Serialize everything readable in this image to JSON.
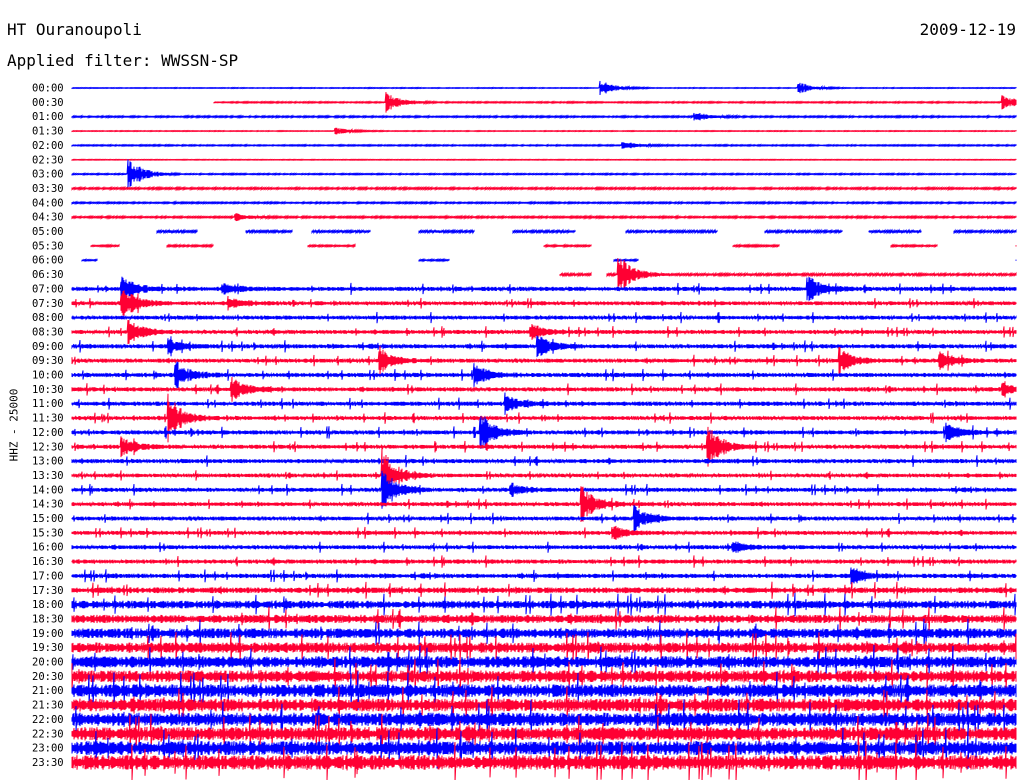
{
  "header": {
    "station": "HT Ouranoupoli",
    "date": "2009-12-19",
    "filter": "Applied filter: WWSSN-SP"
  },
  "axis_label": "HHZ - 25000",
  "colors": {
    "trace_a": "#0000ff",
    "trace_b": "#ff0033"
  },
  "chart_data": {
    "type": "line",
    "ylabel": "HHZ - 25000",
    "y_tick_labels": [
      "00:00",
      "00:30",
      "01:00",
      "01:30",
      "02:00",
      "02:30",
      "03:00",
      "03:30",
      "04:00",
      "04:30",
      "05:00",
      "05:30",
      "06:00",
      "06:30",
      "07:00",
      "07:30",
      "08:00",
      "08:30",
      "09:00",
      "09:30",
      "10:00",
      "10:30",
      "11:00",
      "11:30",
      "12:00",
      "12:30",
      "13:00",
      "13:30",
      "14:00",
      "14:30",
      "15:00",
      "15:30",
      "16:00",
      "16:30",
      "17:00",
      "17:30",
      "18:00",
      "18:30",
      "19:00",
      "19:30",
      "20:00",
      "20:30",
      "21:00",
      "21:30",
      "22:00",
      "22:30",
      "23:00",
      "23:30"
    ],
    "x_range_minutes": [
      0,
      30
    ],
    "series": [
      {
        "noise": 0.3,
        "events": [
          [
            16.8,
            1.3
          ],
          [
            23.1,
            1.0
          ]
        ],
        "gaps": []
      },
      {
        "noise": 0.5,
        "events": [
          [
            10.0,
            1.6
          ],
          [
            29.6,
            1.2
          ]
        ],
        "gaps": [
          [
            0,
            4.5
          ]
        ]
      },
      {
        "noise": 0.6,
        "events": [
          [
            19.8,
            0.8
          ]
        ],
        "gaps": []
      },
      {
        "noise": 0.3,
        "events": [
          [
            8.4,
            0.6
          ]
        ],
        "gaps": []
      },
      {
        "noise": 0.5,
        "events": [
          [
            17.5,
            0.8
          ]
        ],
        "gaps": []
      },
      {
        "noise": 0.3,
        "events": [],
        "gaps": []
      },
      {
        "noise": 0.5,
        "events": [
          [
            1.8,
            2.8
          ]
        ],
        "gaps": []
      },
      {
        "noise": 0.7,
        "events": [],
        "gaps": []
      },
      {
        "noise": 0.6,
        "events": [],
        "gaps": []
      },
      {
        "noise": 0.7,
        "events": [
          [
            5.2,
            0.6
          ]
        ],
        "gaps": []
      },
      {
        "noise": 0.9,
        "events": [],
        "gaps": [
          [
            0,
            2.7
          ],
          [
            4.0,
            5.5
          ],
          [
            7.0,
            7.6
          ],
          [
            9.5,
            11.0
          ],
          [
            12.8,
            14.0
          ],
          [
            16.0,
            17.6
          ],
          [
            20.5,
            22.0
          ],
          [
            24.5,
            25.3
          ],
          [
            27.0,
            28.0
          ]
        ]
      },
      {
        "noise": 0.7,
        "events": [],
        "gaps": [
          [
            0,
            0.6
          ],
          [
            1.5,
            3.0
          ],
          [
            4.5,
            7.5
          ],
          [
            9.0,
            15.0
          ],
          [
            16.5,
            21.0
          ],
          [
            22.5,
            26.0
          ],
          [
            27.5,
            30.0
          ]
        ]
      },
      {
        "noise": 0.6,
        "events": [],
        "gaps": [
          [
            0,
            0.3
          ],
          [
            0.8,
            11.0
          ],
          [
            12.0,
            17.2
          ],
          [
            18.0,
            30.0
          ]
        ]
      },
      {
        "noise": 0.9,
        "events": [
          [
            17.4,
            3.2
          ]
        ],
        "gaps": [
          [
            0,
            15.5
          ],
          [
            16.5,
            17.0
          ]
        ]
      },
      {
        "noise": 1.6,
        "events": [
          [
            1.6,
            2.2
          ],
          [
            4.8,
            1.0
          ],
          [
            23.4,
            2.0
          ]
        ],
        "gaps": []
      },
      {
        "noise": 1.5,
        "events": [
          [
            1.6,
            2.8
          ],
          [
            5.0,
            1.0
          ]
        ],
        "gaps": []
      },
      {
        "noise": 1.5,
        "events": [],
        "gaps": []
      },
      {
        "noise": 1.5,
        "events": [
          [
            1.8,
            2.2
          ],
          [
            14.6,
            1.4
          ]
        ],
        "gaps": []
      },
      {
        "noise": 1.6,
        "events": [
          [
            3.1,
            1.2
          ],
          [
            14.8,
            1.8
          ]
        ],
        "gaps": []
      },
      {
        "noise": 1.5,
        "events": [
          [
            9.8,
            2.0
          ],
          [
            24.4,
            2.0
          ],
          [
            27.6,
            1.5
          ]
        ],
        "gaps": []
      },
      {
        "noise": 1.6,
        "events": [
          [
            3.3,
            2.2
          ],
          [
            12.8,
            1.8
          ]
        ],
        "gaps": []
      },
      {
        "noise": 1.6,
        "events": [
          [
            5.1,
            2.0
          ],
          [
            29.6,
            1.0
          ]
        ],
        "gaps": []
      },
      {
        "noise": 1.6,
        "events": [
          [
            13.8,
            1.6
          ]
        ],
        "gaps": []
      },
      {
        "noise": 1.5,
        "events": [
          [
            3.1,
            3.5
          ]
        ],
        "gaps": []
      },
      {
        "noise": 1.6,
        "events": [
          [
            13.0,
            3.2
          ],
          [
            27.8,
            1.5
          ]
        ],
        "gaps": []
      },
      {
        "noise": 1.5,
        "events": [
          [
            1.6,
            1.6
          ],
          [
            20.2,
            3.5
          ]
        ],
        "gaps": []
      },
      {
        "noise": 1.6,
        "events": [],
        "gaps": []
      },
      {
        "noise": 1.4,
        "events": [
          [
            9.9,
            4.0
          ]
        ],
        "gaps": []
      },
      {
        "noise": 1.5,
        "events": [
          [
            9.9,
            3.2
          ],
          [
            14.0,
            1.0
          ]
        ],
        "gaps": []
      },
      {
        "noise": 1.5,
        "events": [
          [
            16.2,
            3.0
          ]
        ],
        "gaps": []
      },
      {
        "noise": 1.5,
        "events": [
          [
            17.9,
            2.0
          ]
        ],
        "gaps": []
      },
      {
        "noise": 1.5,
        "events": [
          [
            17.2,
            1.2
          ]
        ],
        "gaps": []
      },
      {
        "noise": 1.5,
        "events": [
          [
            21.0,
            1.0
          ]
        ],
        "gaps": []
      },
      {
        "noise": 1.6,
        "events": [],
        "gaps": []
      },
      {
        "noise": 1.7,
        "events": [
          [
            24.8,
            1.2
          ]
        ],
        "gaps": []
      },
      {
        "noise": 2.2,
        "events": [],
        "gaps": []
      },
      {
        "noise": 3.0,
        "events": [],
        "gaps": []
      },
      {
        "noise": 3.2,
        "events": [],
        "gaps": []
      },
      {
        "noise": 3.8,
        "events": [],
        "gaps": []
      },
      {
        "noise": 4.0,
        "events": [],
        "gaps": []
      },
      {
        "noise": 4.5,
        "events": [],
        "gaps": []
      },
      {
        "noise": 4.6,
        "events": [],
        "gaps": []
      },
      {
        "noise": 5.0,
        "events": [],
        "gaps": []
      },
      {
        "noise": 5.0,
        "events": [],
        "gaps": []
      },
      {
        "noise": 5.2,
        "events": [],
        "gaps": []
      },
      {
        "noise": 5.2,
        "events": [],
        "gaps": []
      },
      {
        "noise": 5.4,
        "events": [],
        "gaps": []
      },
      {
        "noise": 5.6,
        "events": [],
        "gaps": []
      }
    ]
  }
}
